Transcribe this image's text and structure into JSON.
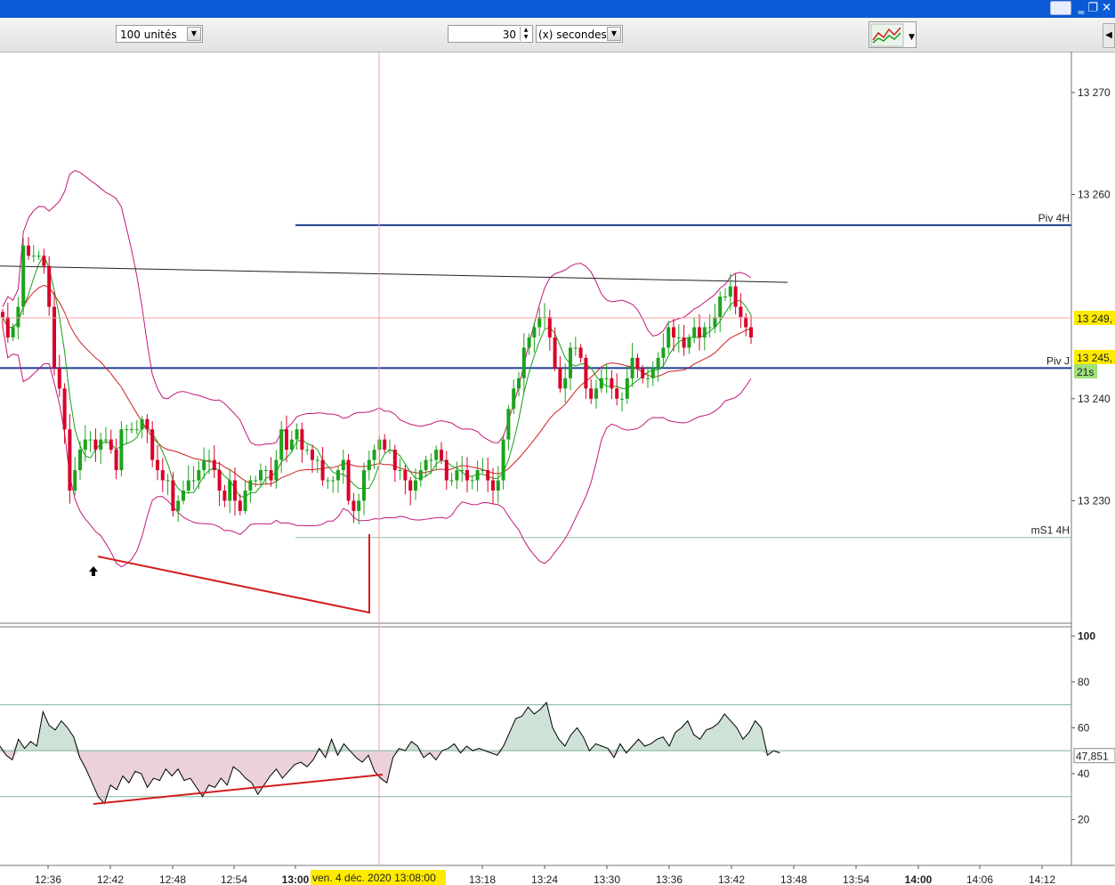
{
  "toolbar": {
    "units_combo": "100 unités",
    "interval_value": "30",
    "interval_unit": "(x) secondes",
    "chart_type_icon": "candlestick-chart-icon"
  },
  "colors": {
    "bull": "#1ca31c",
    "bear": "#d9002a",
    "bollinger": "#c2187a",
    "ma_fast": "#15a015",
    "ma_slow": "#d21e1e",
    "pivot": "#1c3f8f",
    "support": "#8fc1a4",
    "rsi_fill_high": "#cfe2d7",
    "rsi_fill_low": "#ead2d8",
    "price_tag": "#ffea00",
    "timer_tag": "#9ee07a"
  },
  "chart_data": [
    {
      "type": "candlestick",
      "price_axis_ticks": [
        "13 270",
        "13 260",
        "13 240",
        "13 230"
      ],
      "time_axis_ticks": [
        "12:36",
        "12:42",
        "12:48",
        "12:54",
        "13:00",
        "13:18",
        "13:24",
        "13:30",
        "13:36",
        "13:42",
        "13:48",
        "13:54",
        "14:00",
        "14:06",
        "14:12"
      ],
      "crosshair_time_label": "ven. 4 déc. 2020 13:08:00",
      "levels": [
        {
          "label": "Piv 4H",
          "value": 13257.0
        },
        {
          "label": "Piv J",
          "value": 13243.0
        },
        {
          "label": "mS1 4H",
          "value": 13226.4
        }
      ],
      "price_tags": [
        "13 249,",
        "13 245,"
      ],
      "timer_tag": "21s",
      "ylim": [
        13218.0,
        13274.0
      ],
      "close_series": [
        13248,
        13246,
        13247,
        13249,
        13255,
        13254,
        13254,
        13254,
        13253,
        13249,
        13243,
        13241,
        13237,
        13231,
        13233,
        13235,
        13236,
        13236,
        13235,
        13236,
        13236,
        13235,
        13233,
        13237,
        13237,
        13237,
        13237,
        13238,
        13237,
        13234,
        13233,
        13232,
        13232,
        13229,
        13230,
        13231,
        13232,
        13232,
        13233,
        13234,
        13234,
        13233,
        13231,
        13230,
        13232,
        13230,
        13229,
        13231,
        13232,
        13232,
        13233,
        13233,
        13232,
        13234,
        13237,
        13235,
        13236,
        13237,
        13235,
        13235,
        13234,
        13234,
        13232,
        13232,
        13232,
        13233,
        13234,
        13230,
        13229,
        13230,
        13233,
        13234,
        13235,
        13236,
        13235,
        13235,
        13233,
        13233,
        13232,
        13231,
        13232,
        13233,
        13234,
        13234,
        13235,
        13234,
        13232,
        13232,
        13233,
        13233,
        13232,
        13232,
        13233,
        13233,
        13232,
        13231,
        13232,
        13236,
        13239,
        13241,
        13242,
        13245,
        13246,
        13247,
        13248,
        13248,
        13246,
        13243,
        13241,
        13242,
        13245,
        13245,
        13244,
        13241,
        13240,
        13241,
        13242,
        13242,
        13241,
        13240,
        13240,
        13242,
        13244,
        13243,
        13242,
        13242,
        13243,
        13244,
        13245,
        13247,
        13246,
        13246,
        13245,
        13246,
        13247,
        13246,
        13247,
        13247,
        13248,
        13250,
        13250,
        13251,
        13249,
        13248,
        13247,
        13246
      ],
      "rsi": {
        "ticks": [
          "100",
          "80",
          "60",
          "40",
          "20"
        ],
        "ylim": [
          0,
          104
        ],
        "value_tag": "47,851",
        "levels": [
          70,
          50,
          30
        ],
        "values": [
          52,
          48,
          46,
          55,
          51,
          54,
          52,
          67,
          61,
          59,
          63,
          60,
          56,
          47,
          42,
          36,
          30,
          27,
          35,
          33,
          39,
          36,
          41,
          40,
          34,
          38,
          37,
          42,
          39,
          42,
          37,
          38,
          34,
          30,
          35,
          34,
          38,
          35,
          43,
          41,
          38,
          36,
          31,
          35,
          39,
          42,
          38,
          41,
          44,
          45,
          43,
          46,
          51,
          47,
          55,
          48,
          53,
          50,
          47,
          45,
          48,
          41,
          38,
          36,
          47,
          51,
          50,
          54,
          52,
          47,
          49,
          46,
          50,
          51,
          53,
          49,
          52,
          50,
          51,
          50,
          49,
          48,
          52,
          58,
          64,
          65,
          69,
          66,
          68,
          71,
          60,
          55,
          52,
          57,
          60,
          56,
          50,
          53,
          52,
          51,
          47,
          53,
          49,
          52,
          55,
          52,
          53,
          55,
          56,
          52,
          58,
          60,
          63,
          57,
          55,
          59,
          60,
          62,
          66,
          63,
          60,
          55,
          58,
          63,
          60,
          48,
          50,
          49
        ]
      }
    }
  ]
}
